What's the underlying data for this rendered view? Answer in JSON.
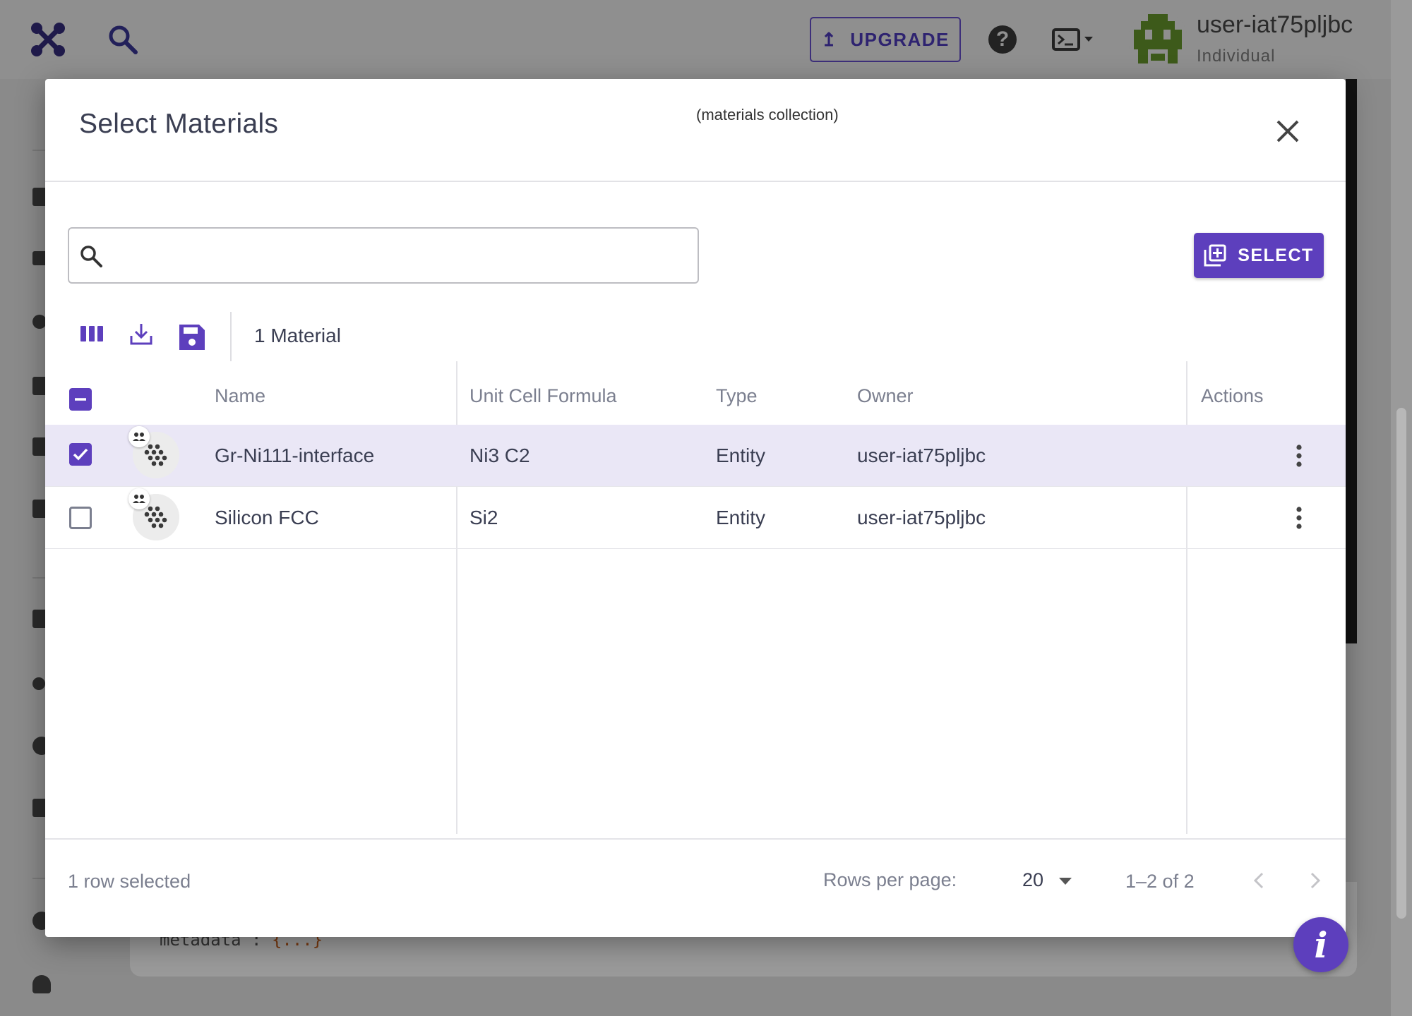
{
  "app_bar": {
    "upgrade_label": "UPGRADE",
    "user_name": "user-iat75pljbc",
    "user_role": "Individual"
  },
  "background": {
    "code_key": "metadata",
    "code_sep": " : ",
    "code_value": "{...}"
  },
  "modal": {
    "title": "Select Materials",
    "subtitle": "(materials collection)",
    "search": {
      "value": "",
      "placeholder": ""
    },
    "select_button_label": "SELECT",
    "material_count": "1 Material",
    "columns": {
      "name": "Name",
      "formula": "Unit Cell Formula",
      "type": "Type",
      "owner": "Owner",
      "actions": "Actions"
    },
    "rows": [
      {
        "name": "Gr-Ni111-interface",
        "formula": "Ni3 C2",
        "type": "Entity",
        "owner": "user-iat75pljbc",
        "selected": true
      },
      {
        "name": "Silicon FCC",
        "formula": "Si2",
        "type": "Entity",
        "owner": "user-iat75pljbc",
        "selected": false
      }
    ],
    "footer": {
      "selection_text": "1 row selected",
      "rows_per_page_label": "Rows per page:",
      "rows_per_page_value": "20",
      "page_range": "1–2 of 2"
    }
  },
  "colors": {
    "accent": "#5d3fbd",
    "selected_row": "#eae7f6",
    "text_primary": "#3a3e52",
    "text_secondary": "#7b7f8f"
  },
  "icons": {
    "logo": "app-logo-icon",
    "search": "search-icon",
    "help": "help-icon",
    "terminal": "terminal-icon",
    "close": "close-icon",
    "columns": "columns-icon",
    "download": "download-icon",
    "save": "save-icon",
    "add_box": "add-box-icon",
    "more": "more-vert-icon",
    "info": "info-icon"
  }
}
